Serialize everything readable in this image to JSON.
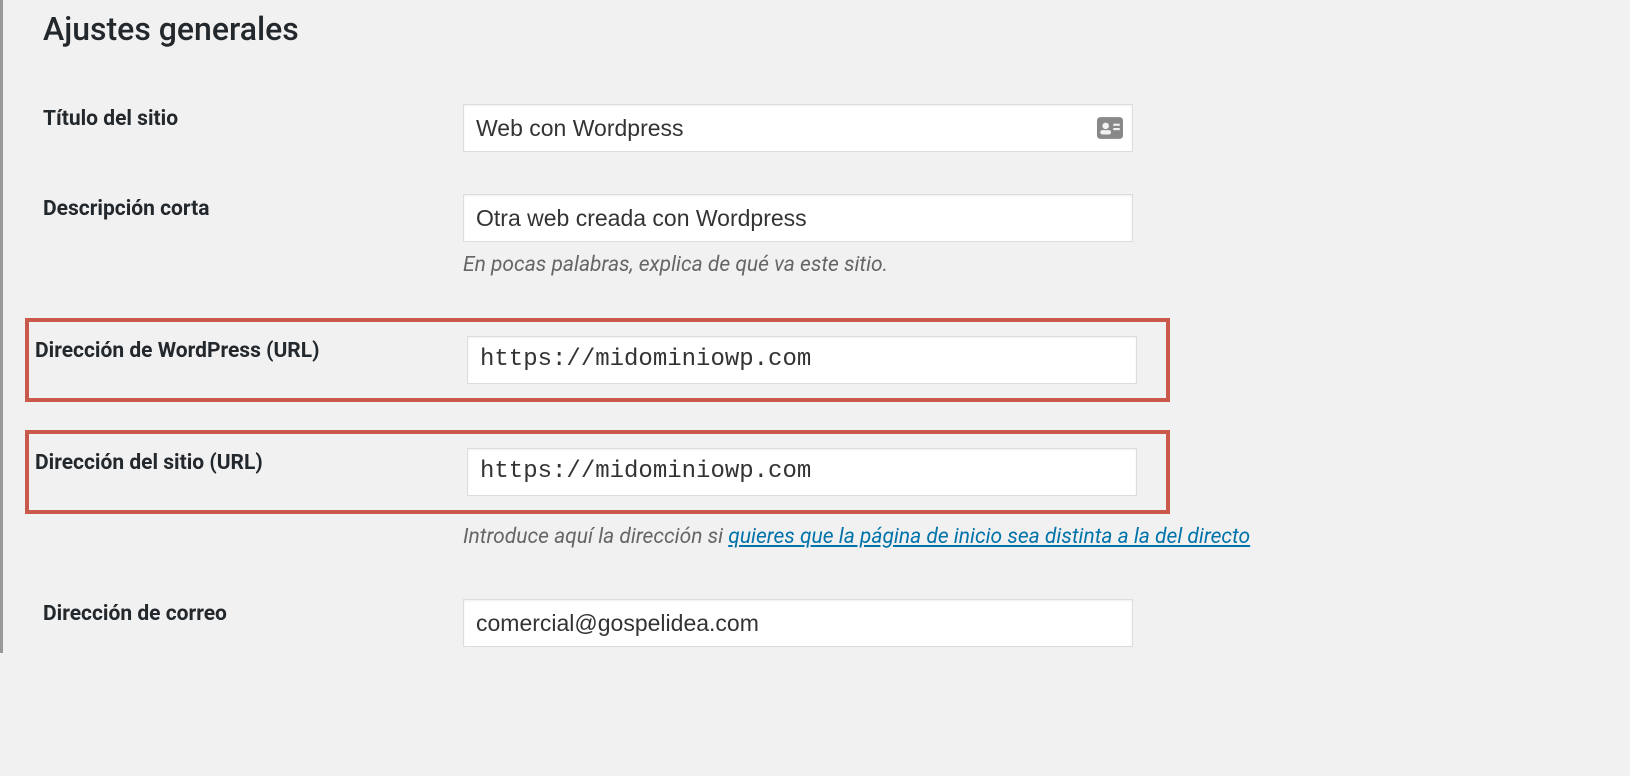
{
  "page": {
    "title": "Ajustes generales"
  },
  "fields": {
    "site_title": {
      "label": "Título del sitio",
      "value": "Web con Wordpress"
    },
    "tagline": {
      "label": "Descripción corta",
      "value": "Otra web creada con Wordpress",
      "description": "En pocas palabras, explica de qué va este sitio."
    },
    "wp_url": {
      "label": "Dirección de WordPress (URL)",
      "value": "https://midominiowp.com"
    },
    "site_url": {
      "label": "Dirección del sitio (URL)",
      "value": "https://midominiowp.com",
      "description_prefix": "Introduce aquí la dirección si ",
      "description_link": "quieres que la página de inicio sea distinta a la del directo"
    },
    "email": {
      "label": "Dirección de correo",
      "value": "comercial@gospelidea.com"
    }
  }
}
